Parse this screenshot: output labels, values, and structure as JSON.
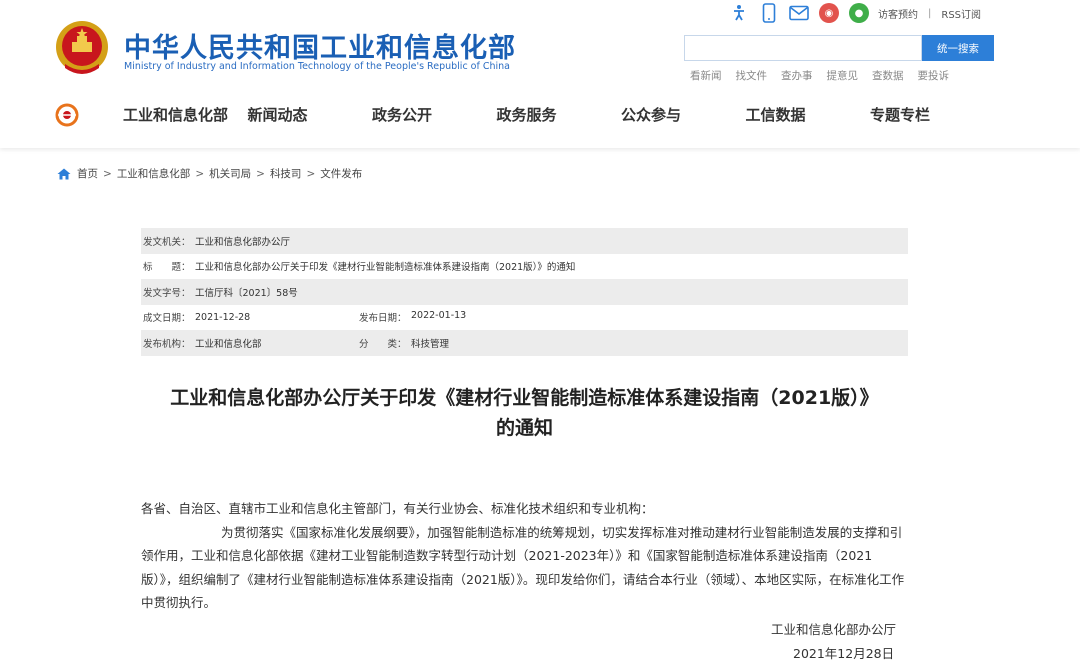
{
  "site": {
    "title": "中华人民共和国工业和信息化部",
    "subtitle": "Ministry of Industry and Information Technology of the People's Republic of China"
  },
  "top_bar": {
    "icons": [
      "accessibility-icon",
      "mobile-icon",
      "mail-icon",
      "weibo-icon",
      "wechat-icon"
    ],
    "links": [
      "访客预约",
      "RSS订阅"
    ],
    "separator": "|"
  },
  "search": {
    "placeholder": "",
    "button_label": "统一搜索"
  },
  "quick_links": [
    "看新闻",
    "找文件",
    "查办事",
    "提意见",
    "查数据",
    "要投诉"
  ],
  "nav": {
    "items": [
      "工业和信息化部",
      "新闻动态",
      "政务公开",
      "政务服务",
      "公众参与",
      "工信数据",
      "专题专栏"
    ]
  },
  "breadcrumb": {
    "items": [
      "首页",
      "工业和信息化部",
      "机关司局",
      "科技司",
      "文件发布"
    ],
    "separator": ">"
  },
  "meta": {
    "issuer_label": "发文机关：",
    "issuer": "工业和信息化部办公厅",
    "title_label": "标　　题：",
    "title": "工业和信息化部办公厅关于印发《建材行业智能制造标准体系建设指南（2021版）》的通知",
    "doc_no_label": "发文字号：",
    "doc_no": "工信厅科〔2021〕58号",
    "written_label": "成文日期：",
    "written": "2021-12-28",
    "published_label": "发布日期：",
    "published": "2022-01-13",
    "publisher_label": "发布机构：",
    "publisher": "工业和信息化部",
    "category_label": "分　　类：",
    "category": "科技管理"
  },
  "article": {
    "title_line1": "工业和信息化部办公厅关于印发《建材行业智能制造标准体系建设指南（2021版）》",
    "title_line2": "的通知",
    "salutation": "各省、自治区、直辖市工业和信息化主管部门，有关行业协会、标准化技术组织和专业机构：",
    "body": "为贯彻落实《国家标准化发展纲要》，加强智能制造标准的统筹规划，切实发挥标准对推动建材行业智能制造发展的支撑和引领作用，工业和信息化部依据《建材工业智能制造数字转型行动计划（2021-2023年）》和《国家智能制造标准体系建设指南（2021版）》，组织编制了《建材行业智能制造标准体系建设指南（2021版）》。现印发给你们，请结合本行业（领域）、本地区实际，在标准化工作中贯彻执行。",
    "sign_org": "工业和信息化部办公厅",
    "sign_date": "2021年12月28日"
  },
  "colors": {
    "brand_blue": "#1a5fb4",
    "search_button": "#2d7fd8",
    "meta_shade": "#ececec"
  }
}
